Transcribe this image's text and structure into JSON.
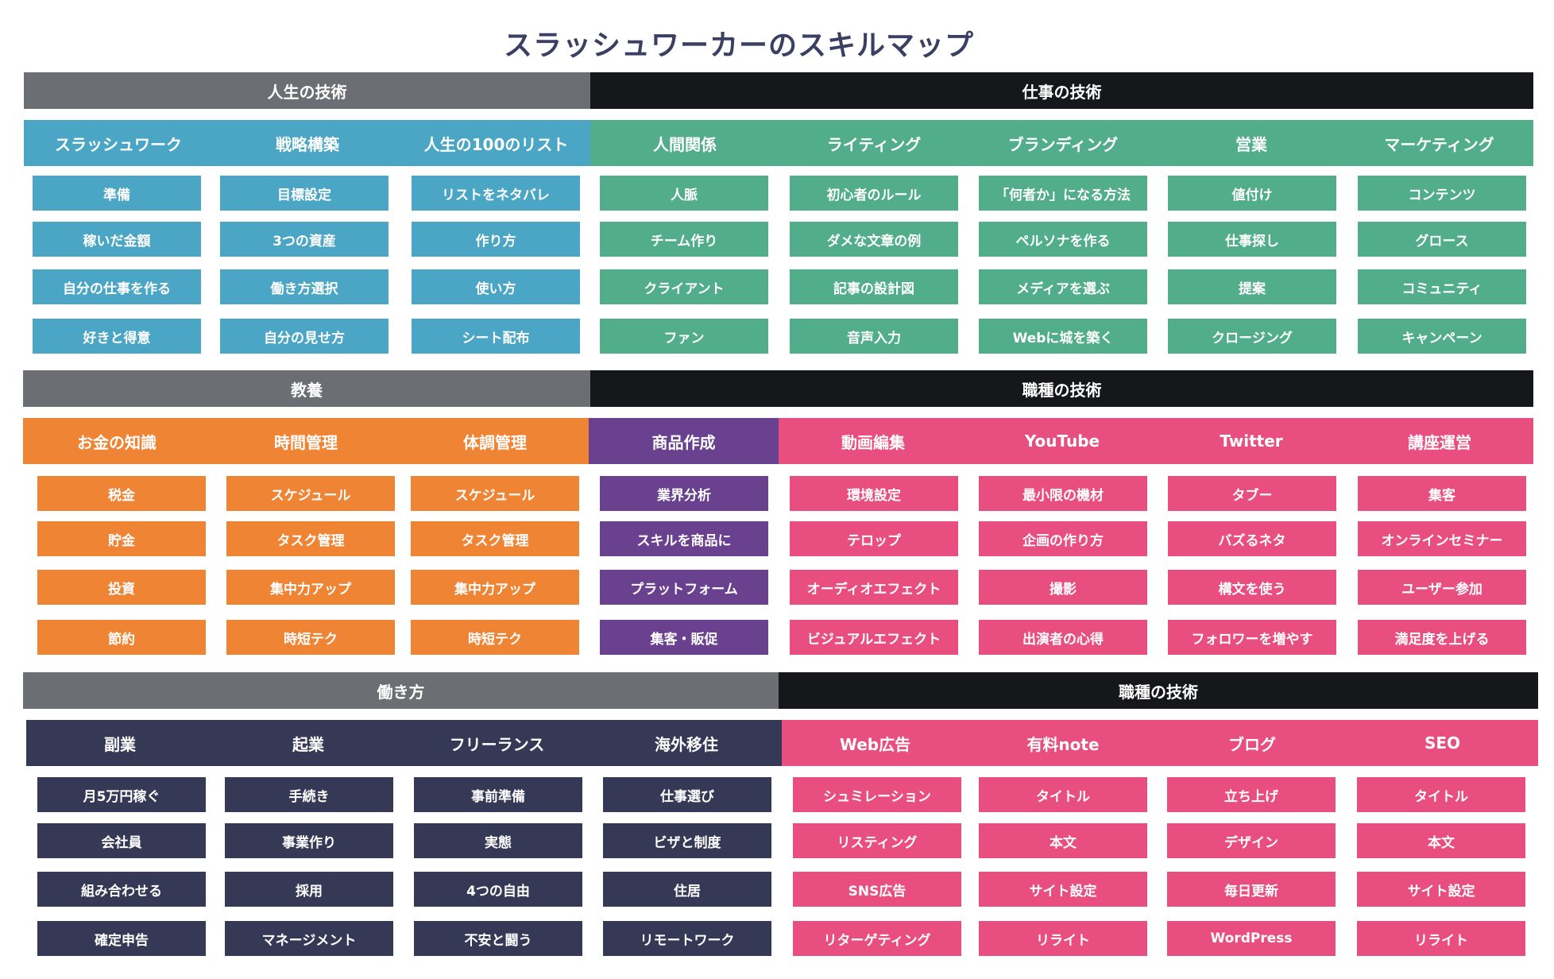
{
  "title": "スラッシュワーカーのスキルマップ",
  "sections": [
    {
      "bands": [
        "人生の技術",
        "仕事の技術"
      ],
      "columns": [
        {
          "label": "スラッシュワーク",
          "color": "#4aa6c4",
          "items": [
            "準備",
            "稼いだ金額",
            "自分の仕事を作る",
            "好きと得意"
          ]
        },
        {
          "label": "戦略構築",
          "color": "#4aa6c4",
          "items": [
            "目標設定",
            "3つの資産",
            "働き方選択",
            "自分の見せ方"
          ]
        },
        {
          "label": "人生の100のリスト",
          "color": "#4aa6c4",
          "items": [
            "リストをネタバレ",
            "作り方",
            "使い方",
            "シート配布"
          ]
        },
        {
          "label": "人間関係",
          "color": "#52ad8a",
          "items": [
            "人脈",
            "チーム作り",
            "クライアント",
            "ファン"
          ]
        },
        {
          "label": "ライティング",
          "color": "#52ad8a",
          "items": [
            "初心者のルール",
            "ダメな文章の例",
            "記事の設計図",
            "音声入力"
          ]
        },
        {
          "label": "ブランディング",
          "color": "#52ad8a",
          "items": [
            "「何者か」になる方法",
            "ペルソナを作る",
            "メディアを選ぶ",
            "Webに城を築く"
          ]
        },
        {
          "label": "営業",
          "color": "#52ad8a",
          "items": [
            "値付け",
            "仕事探し",
            "提案",
            "クロージング"
          ]
        },
        {
          "label": "マーケティング",
          "color": "#52ad8a",
          "items": [
            "コンテンツ",
            "グロース",
            "コミュニティ",
            "キャンペーン"
          ]
        }
      ]
    },
    {
      "bands": [
        "教養",
        "職種の技術"
      ],
      "columns": [
        {
          "label": "お金の知識",
          "color": "#ee8434",
          "items": [
            "税金",
            "貯金",
            "投資",
            "節約"
          ]
        },
        {
          "label": "時間管理",
          "color": "#ee8434",
          "items": [
            "スケジュール",
            "タスク管理",
            "集中力アップ",
            "時短テク"
          ]
        },
        {
          "label": "体調管理",
          "color": "#ee8434",
          "items": [
            "スケジュール",
            "タスク管理",
            "集中力アップ",
            "時短テク"
          ]
        },
        {
          "label": "商品作成",
          "color": "#69418f",
          "items": [
            "業界分析",
            "スキルを商品に",
            "プラットフォーム",
            "集客・販促"
          ]
        },
        {
          "label": "動画編集",
          "color": "#e94e80",
          "items": [
            "環境設定",
            "テロップ",
            "オーディオエフェクト",
            "ビジュアルエフェクト"
          ]
        },
        {
          "label": "YouTube",
          "color": "#e94e80",
          "items": [
            "最小限の機材",
            "企画の作り方",
            "撮影",
            "出演者の心得"
          ]
        },
        {
          "label": "Twitter",
          "color": "#e94e80",
          "items": [
            "タブー",
            "バズるネタ",
            "構文を使う",
            "フォロワーを増やす"
          ]
        },
        {
          "label": "講座運営",
          "color": "#e94e80",
          "items": [
            "集客",
            "オンラインセミナー",
            "ユーザー参加",
            "満足度を上げる"
          ]
        }
      ]
    },
    {
      "bands": [
        "働き方",
        "職種の技術"
      ],
      "columns": [
        {
          "label": "副業",
          "color": "#363955",
          "items": [
            "月5万円稼ぐ",
            "会社員",
            "組み合わせる",
            "確定申告"
          ]
        },
        {
          "label": "起業",
          "color": "#363955",
          "items": [
            "手続き",
            "事業作り",
            "採用",
            "マネージメント"
          ]
        },
        {
          "label": "フリーランス",
          "color": "#363955",
          "items": [
            "事前準備",
            "実態",
            "4つの自由",
            "不安と闘う"
          ]
        },
        {
          "label": "海外移住",
          "color": "#363955",
          "items": [
            "仕事選び",
            "ビザと制度",
            "住居",
            "リモートワーク"
          ]
        },
        {
          "label": "Web広告",
          "color": "#e94e80",
          "items": [
            "シュミレーション",
            "リスティング",
            "SNS広告",
            "リターゲティング"
          ]
        },
        {
          "label": "有料note",
          "color": "#e94e80",
          "items": [
            "タイトル",
            "本文",
            "サイト設定",
            "リライト"
          ]
        },
        {
          "label": "ブログ",
          "color": "#e94e80",
          "items": [
            "立ち上げ",
            "デザイン",
            "毎日更新",
            "WordPress"
          ]
        },
        {
          "label": "SEO",
          "color": "#e94e80",
          "items": [
            "タイトル",
            "本文",
            "サイト設定",
            "リライト"
          ]
        }
      ]
    }
  ]
}
